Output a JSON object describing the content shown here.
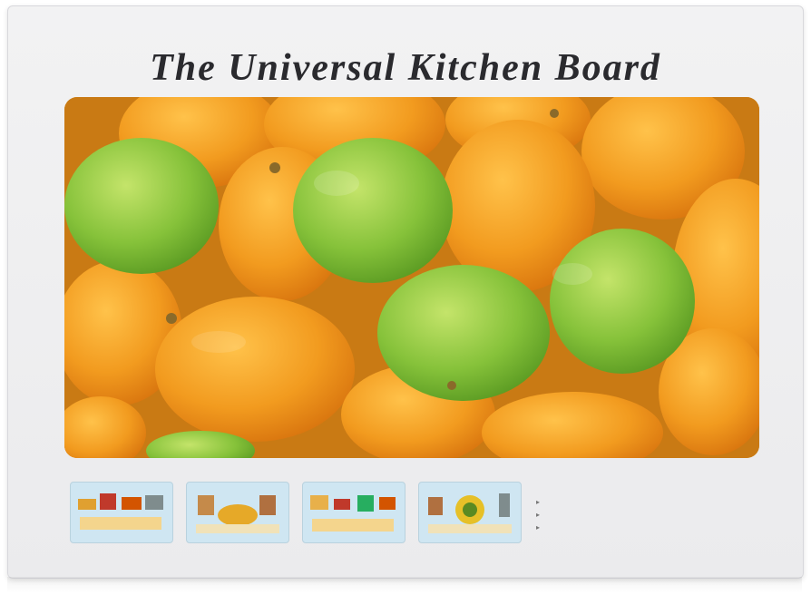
{
  "product": {
    "title": "The Universal Kitchen Board",
    "photo_subject": "lemons-and-limes",
    "fruit_colors": {
      "lemon": "#f2a327",
      "lime": "#8cc63f",
      "background": "#d8961c"
    }
  },
  "thumbnails": [
    {
      "caption": "",
      "icon": "kitchen-scene-thumbnail"
    },
    {
      "caption": "",
      "icon": "pot-stand-thumbnail"
    },
    {
      "caption": "",
      "icon": "serving-board-thumbnail"
    },
    {
      "caption": "",
      "icon": "worktop-saver-thumbnail"
    }
  ],
  "bullets": [
    "",
    "",
    ""
  ]
}
